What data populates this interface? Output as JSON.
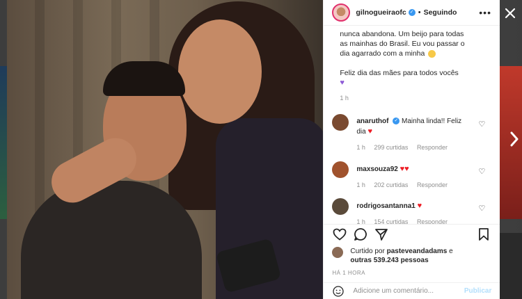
{
  "header": {
    "username": "gilnogueiraofc",
    "follow_status": "Seguindo",
    "dot": "•",
    "more": "•••"
  },
  "caption": {
    "lines": [
      "nunca abandona. Um beijo para todas",
      "as mainhas do Brasil. Eu vou passar o",
      "dia agarrado com a minha",
      "",
      "Feliz dia das mães para todos vocês"
    ],
    "time": "1 h"
  },
  "comments": [
    {
      "user": "anaruthof",
      "text_line1": "Mainha linda!! Feliz",
      "text_line2": "dia",
      "time": "1 h",
      "likes": "299 curtidas",
      "reply": "Responder",
      "avatar_color": "#7a4a30"
    },
    {
      "user": "maxsouza92",
      "text_line1": "",
      "text_line2": "",
      "time": "1 h",
      "likes": "202 curtidas",
      "reply": "Responder",
      "avatar_color": "#a0522d"
    },
    {
      "user": "rodrigosantanna1",
      "text_line1": "",
      "text_line2": "",
      "time": "1 h",
      "likes": "154 curtidas",
      "reply": "Responder",
      "avatar_color": "#5a4a3a"
    }
  ],
  "likes": {
    "prefix": "Curtido por",
    "user": "pasteveandadams",
    "conj": "e",
    "others": "outras 539.243 pessoas"
  },
  "post_time": "HÁ 1 HORA",
  "comment_box": {
    "placeholder": "Adicione um comentário...",
    "publish_label": "Publicar"
  },
  "colors": {
    "verified": "#3897f0",
    "heart_red": "#ed1c24",
    "heart_purple": "#8e5bd6",
    "publish_disabled": "#b2dffc"
  }
}
